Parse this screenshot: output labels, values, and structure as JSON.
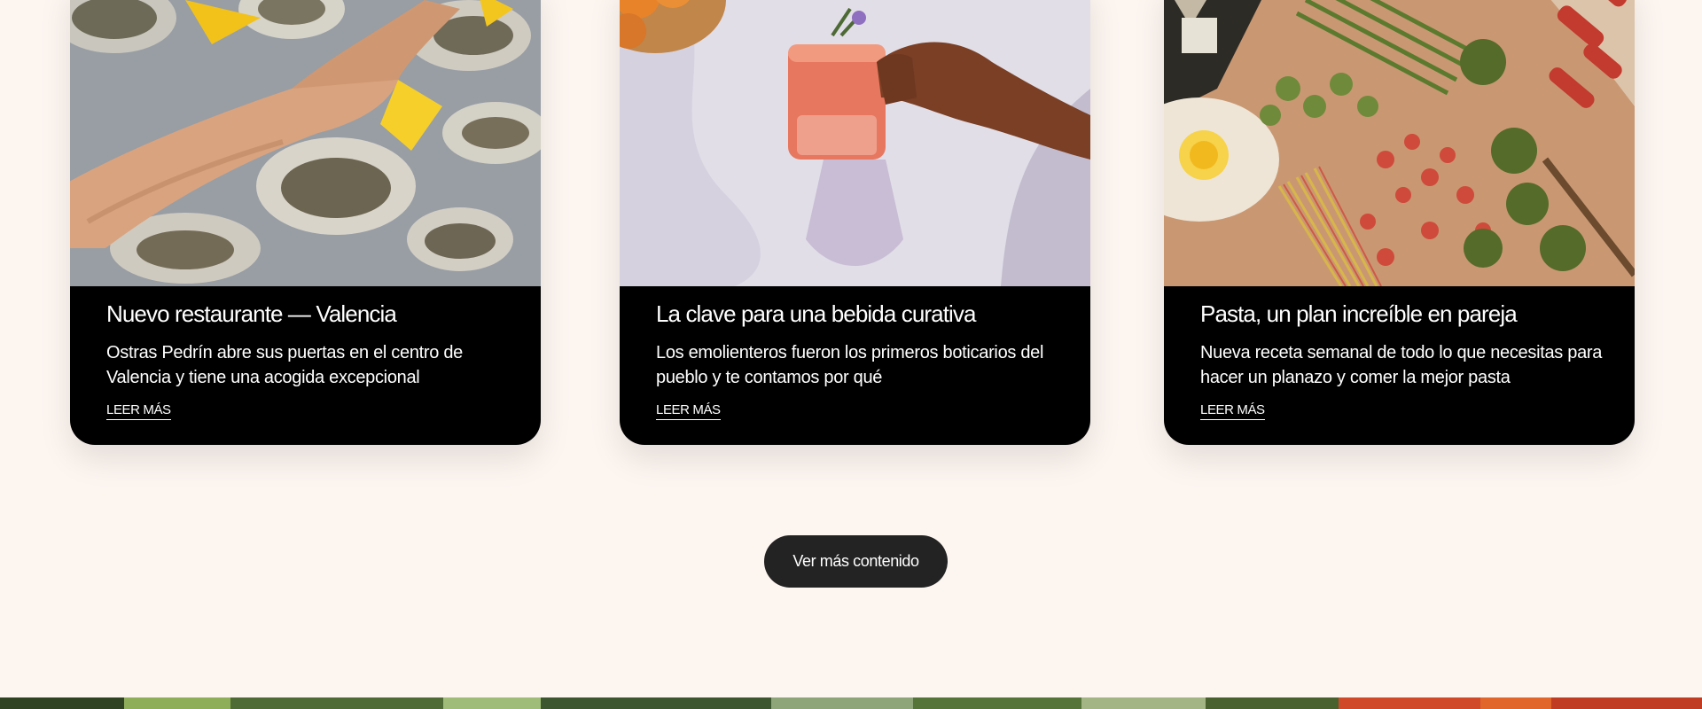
{
  "cards": [
    {
      "title": "Nuevo restaurante — Valencia",
      "description": "Ostras Pedrín abre sus puertas en el centro de Valencia y tiene una acogida excepcional",
      "link_label": "LEER MÁS",
      "image": "oysters-with-lemon-photo"
    },
    {
      "title": "La clave para una bebida curativa",
      "description": "Los emolienteros fueron los primeros boticarios del pueblo y te contamos por qué",
      "link_label": "LEER MÁS",
      "image": "hand-holding-drink-glass-photo"
    },
    {
      "title": "Pasta, un plan increíble en pareja",
      "description": "Nueva receta semanal de todo lo que necesitas para hacer un planazo y comer la mejor pasta",
      "link_label": "LEER MÁS",
      "image": "fresh-pasta-table-photo"
    }
  ],
  "more_button": {
    "label": "Ver más contenido"
  },
  "colors": {
    "page_background": "#fdf5f0",
    "card_background": "#000000",
    "button_background": "#232323",
    "text_on_dark": "#ffffff"
  }
}
